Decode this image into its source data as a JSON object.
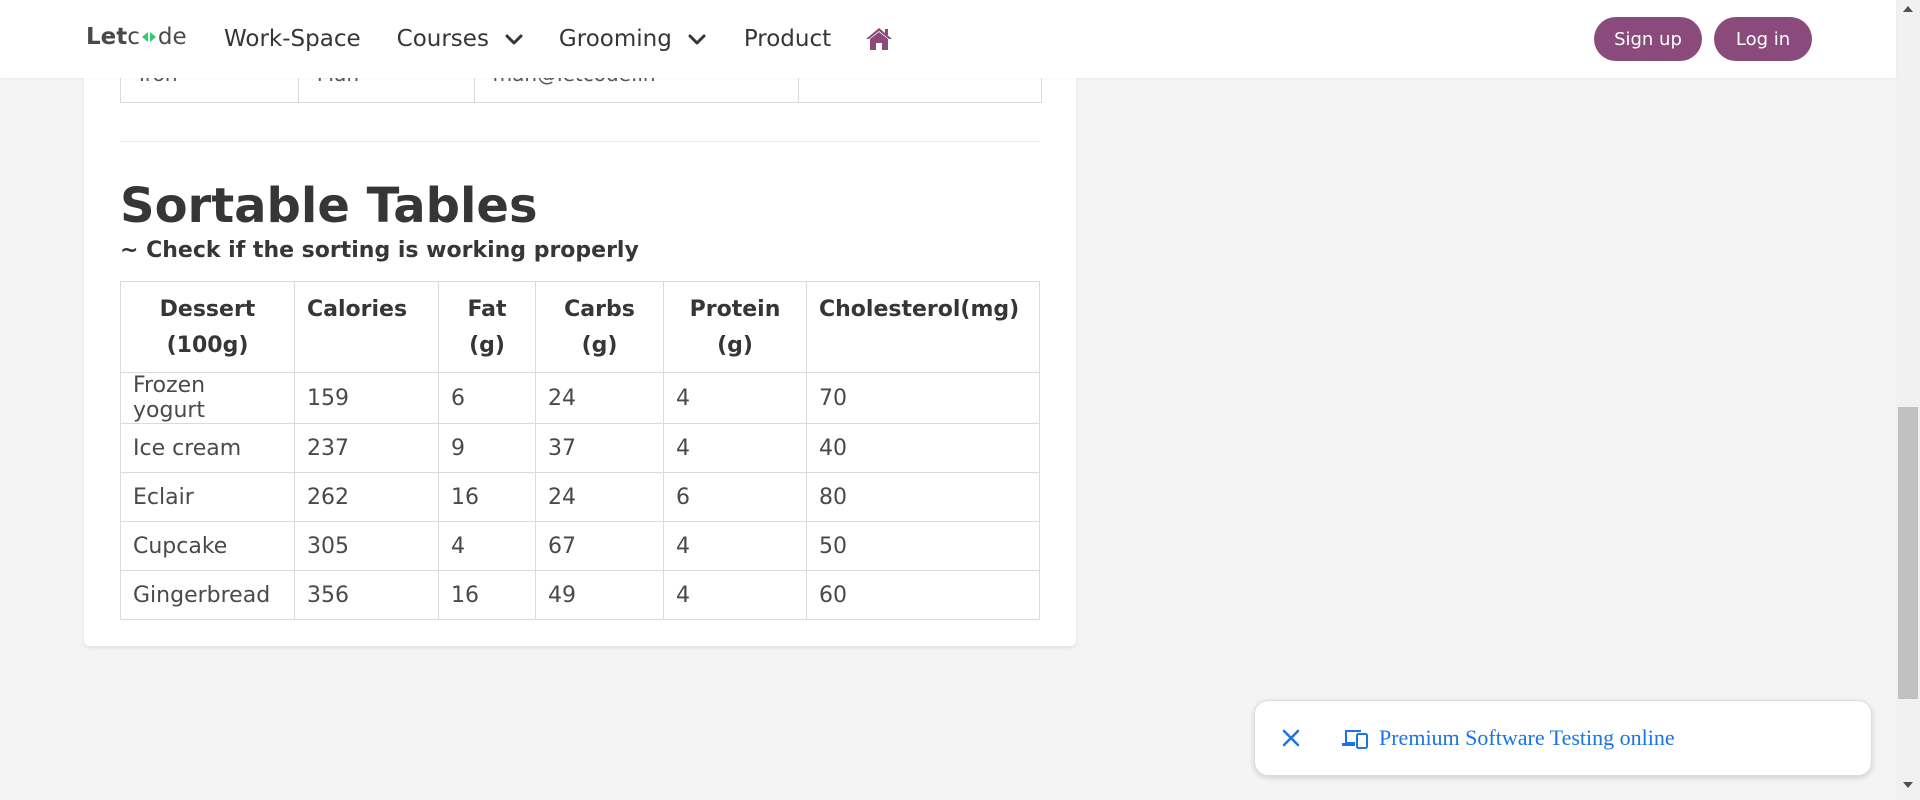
{
  "navbar": {
    "logo_let": "Let",
    "logo_c": "c",
    "logo_de": "de",
    "items": [
      {
        "label": "Work-Space",
        "has_dropdown": false
      },
      {
        "label": "Courses",
        "has_dropdown": true
      },
      {
        "label": "Grooming",
        "has_dropdown": true
      },
      {
        "label": "Product",
        "has_dropdown": false
      }
    ],
    "home_icon": "home-icon",
    "signup_label": "Sign up",
    "login_label": "Log in",
    "accent_color": "#8b4a7c"
  },
  "previous_table_row": {
    "first": "Iron",
    "last": "Man",
    "email": "man@letcode.in"
  },
  "section": {
    "title": "Sortable Tables",
    "subtitle": "~ Check if the sorting is working properly"
  },
  "table": {
    "headers": [
      {
        "line1": "Dessert",
        "line2": "(100g)"
      },
      {
        "line1": "Calories",
        "line2": ""
      },
      {
        "line1": "Fat",
        "line2": "(g)"
      },
      {
        "line1": "Carbs",
        "line2": "(g)"
      },
      {
        "line1": "Protein",
        "line2": "(g)"
      },
      {
        "line1": "Cholesterol(mg)",
        "line2": ""
      }
    ],
    "rows": [
      [
        "Frozen yogurt",
        "159",
        "6",
        "24",
        "4",
        "70"
      ],
      [
        "Ice cream",
        "237",
        "9",
        "37",
        "4",
        "40"
      ],
      [
        "Eclair",
        "262",
        "16",
        "24",
        "6",
        "80"
      ],
      [
        "Cupcake",
        "305",
        "4",
        "67",
        "4",
        "50"
      ],
      [
        "Gingerbread",
        "356",
        "16",
        "49",
        "4",
        "60"
      ]
    ]
  },
  "ad": {
    "text": "Premium Software Testing online",
    "close_icon": "close-icon",
    "devices_icon": "devices-icon",
    "link_color": "#1a73e8"
  }
}
